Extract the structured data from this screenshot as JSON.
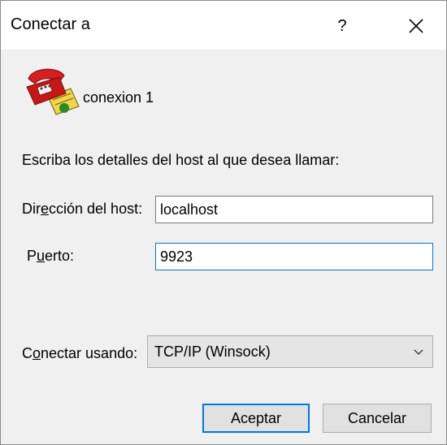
{
  "window": {
    "title": "Conectar a",
    "help_label": "?"
  },
  "connection": {
    "name": "conexion 1",
    "icon": "telephone-icon"
  },
  "form": {
    "instructions": "Escriba los detalles del host al que desea llamar:",
    "host_label": "Dirección del host:",
    "host_value": "localhost",
    "port_label": "Puerto:",
    "port_value": "9923",
    "connect_using_label": "Conectar usando:",
    "connect_using_value": "TCP/IP (Winsock)"
  },
  "buttons": {
    "ok_label": "Aceptar",
    "cancel_label": "Cancelar"
  },
  "colors": {
    "accent": "#0078d7",
    "phone_red": "#d62020",
    "paper_yellow": "#f2d44a"
  }
}
